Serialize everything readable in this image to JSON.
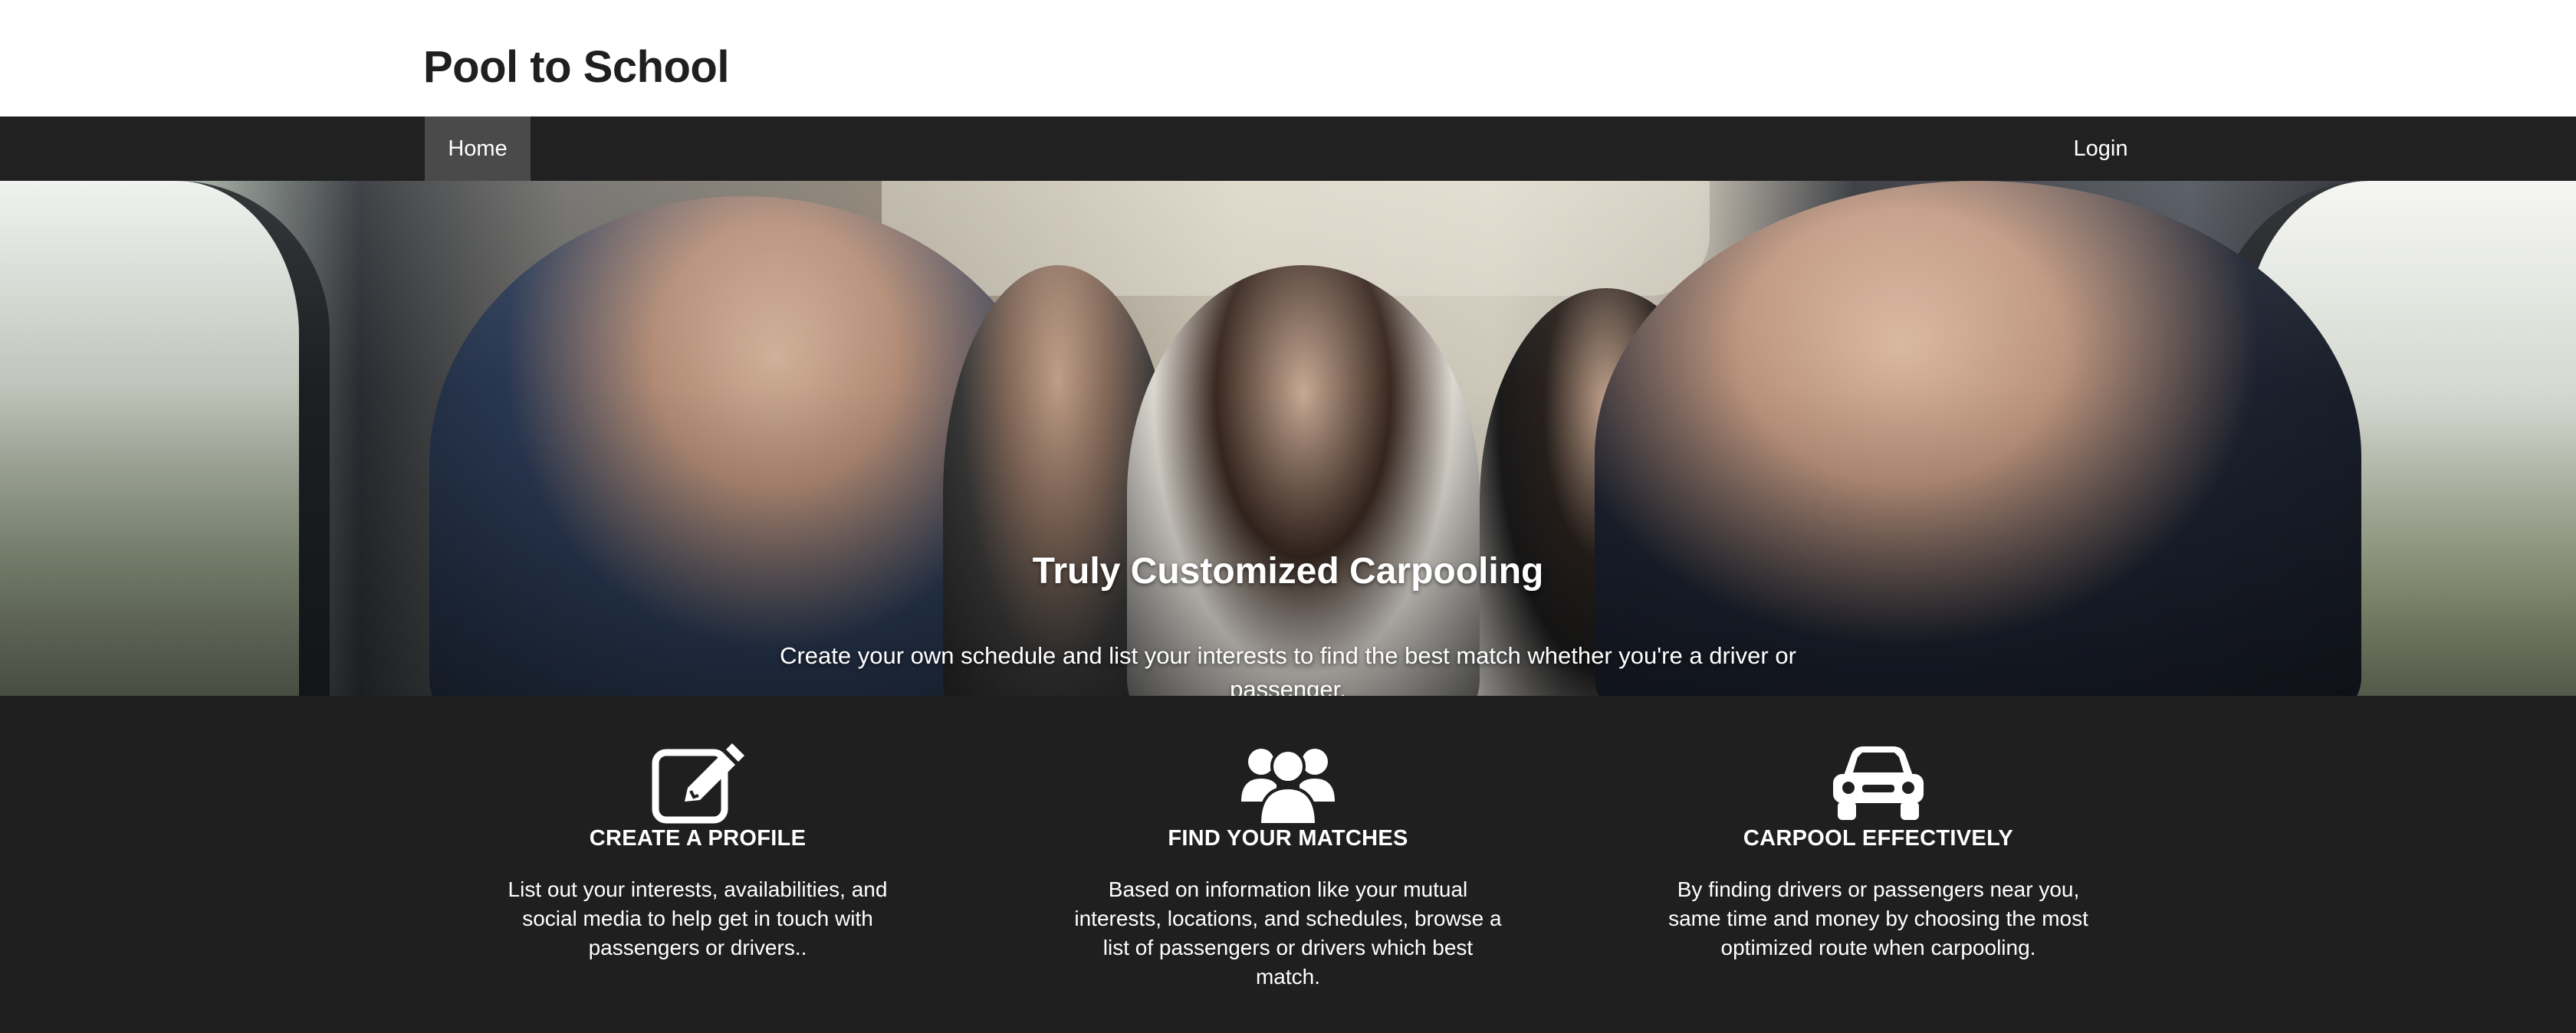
{
  "header": {
    "brand": "Pool to School"
  },
  "nav": {
    "home_label": "Home",
    "login_label": "Login"
  },
  "hero": {
    "title": "Truly Customized Carpooling",
    "subtitle": "Create your own schedule and list your interests to find the best match whether you're a driver or passenger."
  },
  "features": [
    {
      "icon": "edit-icon",
      "title": "CREATE A PROFILE",
      "description": "List out your interests, availabilities, and social media to help get in touch with passengers or drivers.."
    },
    {
      "icon": "users-icon",
      "title": "FIND YOUR MATCHES",
      "description": "Based on information like your mutual interests, locations, and schedules, browse a list of passengers or drivers which best match."
    },
    {
      "icon": "car-icon",
      "title": "CARPOOL EFFECTIVELY",
      "description": "By finding drivers or passengers near you, same time and money by choosing the most optimized route when carpooling."
    }
  ],
  "colors": {
    "navbar": "#212121",
    "nav_active": "#4a4a4a",
    "features_bg": "#1f1f1f",
    "text_light": "#ffffff"
  }
}
